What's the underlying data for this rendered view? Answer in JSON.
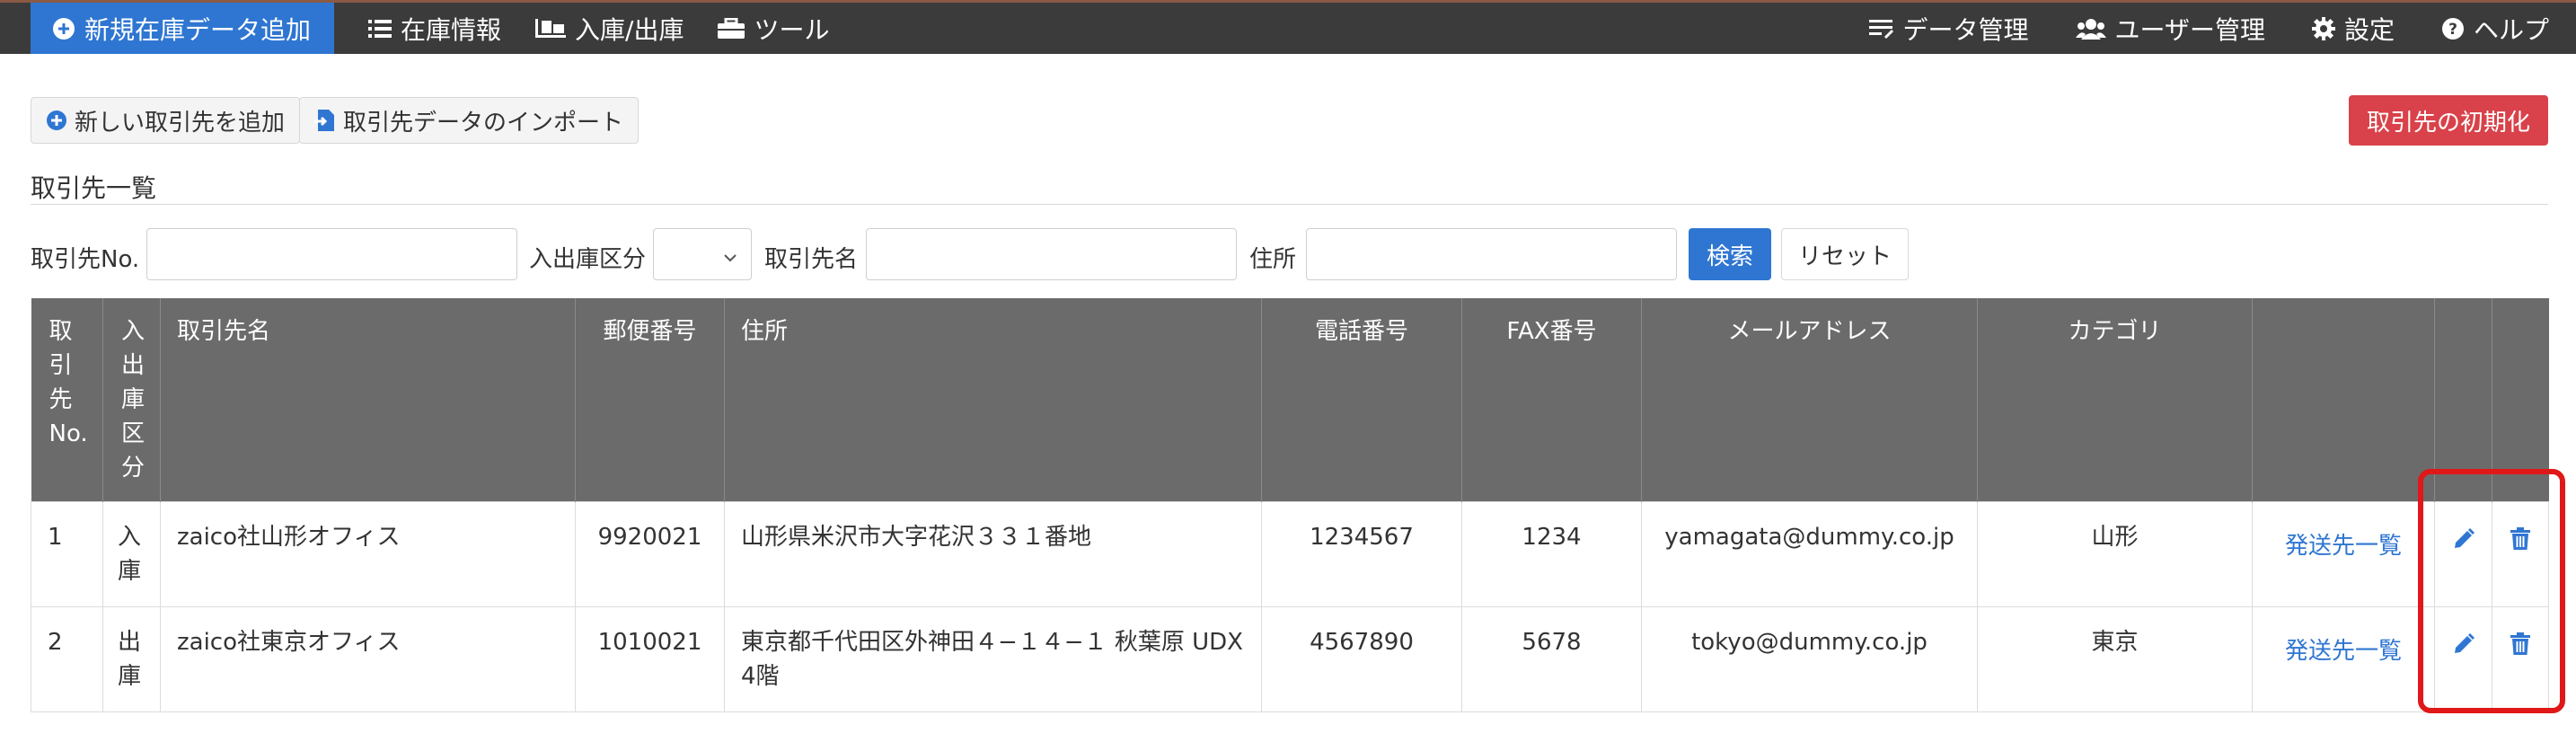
{
  "nav": {
    "left": [
      {
        "label": "新規在庫データ追加",
        "icon": "plus-circle-icon"
      },
      {
        "label": "在庫情報",
        "icon": "list-icon"
      },
      {
        "label": "入庫/出庫",
        "icon": "dolly-icon"
      },
      {
        "label": "ツール",
        "icon": "toolbox-icon"
      }
    ],
    "right": [
      {
        "label": "データ管理",
        "icon": "data-list-icon"
      },
      {
        "label": "ユーザー管理",
        "icon": "users-icon"
      },
      {
        "label": "設定",
        "icon": "gear-icon"
      },
      {
        "label": "ヘルプ",
        "icon": "help-icon"
      }
    ]
  },
  "toolbar": {
    "add_label": "新しい取引先を追加",
    "import_label": "取引先データのインポート",
    "reset_label": "取引先の初期化"
  },
  "section": {
    "title": "取引先一覧"
  },
  "search": {
    "no_label": "取引先No.",
    "type_label": "入出庫区分",
    "name_label": "取引先名",
    "address_label": "住所",
    "search_button": "検索",
    "reset_button": "リセット"
  },
  "table": {
    "headers": [
      "取引先No.",
      "入出庫区分",
      "取引先名",
      "郵便番号",
      "住所",
      "電話番号",
      "FAX番号",
      "メールアドレス",
      "カテゴリ"
    ],
    "rows": [
      {
        "no": "1",
        "type": "入庫",
        "name": "zaico社山形オフィス",
        "postal": "9920021",
        "address": "山形県米沢市大字花沢３３１番地",
        "phone": "1234567",
        "fax": "1234",
        "email": "yamagata@dummy.co.jp",
        "category": "山形",
        "link": "発送先一覧"
      },
      {
        "no": "2",
        "type": "出庫",
        "name": "zaico社東京オフィス",
        "postal": "1010021",
        "address": "東京都千代田区外神田４−１４−１ 秋葉原 UDX 4階",
        "phone": "4567890",
        "fax": "5678",
        "email": "tokyo@dummy.co.jp",
        "category": "東京",
        "link": "発送先一覧"
      }
    ]
  },
  "colors": {
    "accent": "#2f76d2",
    "danger": "#d9424a",
    "highlight": "#e01818",
    "nav_bg": "#3b3b3b",
    "header_bg": "#6b6b6b"
  }
}
